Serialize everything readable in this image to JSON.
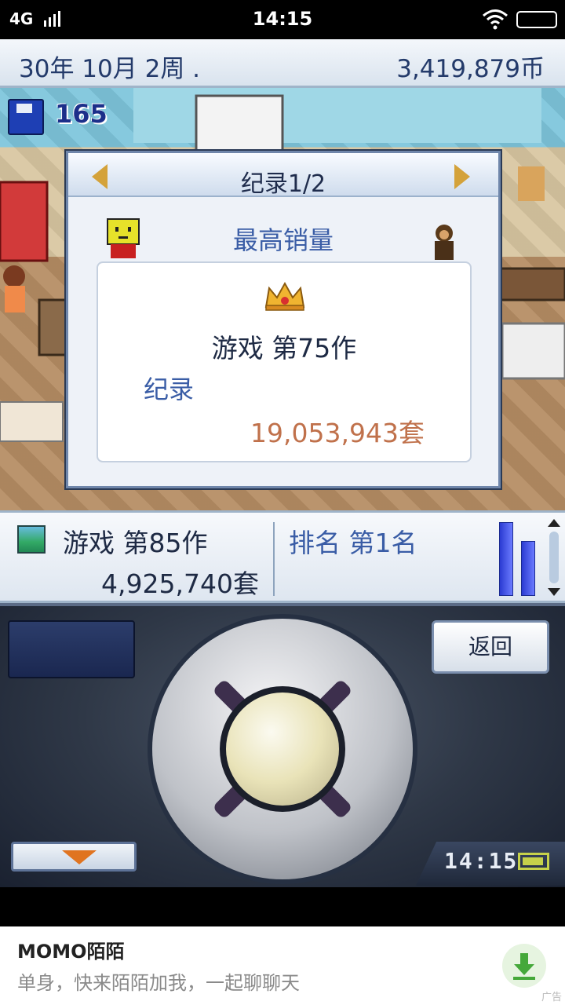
{
  "status_bar": {
    "network": "4G",
    "time": "14:15"
  },
  "top_bar": {
    "date": "30年 10月 2周 .",
    "money": "3,419,879币"
  },
  "scene": {
    "staff_count": "165"
  },
  "record_dialog": {
    "title": "纪录1/2",
    "subtitle": "最高销量",
    "game": "游戏 第75作",
    "label": "纪录",
    "value": "19,053,943套"
  },
  "info_panel": {
    "game_name": "游戏 第85作",
    "sales": "4,925,740套",
    "rank": "排名 第1名"
  },
  "controller": {
    "back_label": "返回",
    "clock": "14:15"
  },
  "ad": {
    "title": "MOMO陌陌",
    "description": "单身，快来陌陌加我，一起聊聊天",
    "tag": "广告"
  },
  "colors": {
    "accent": "#3a5da6",
    "value": "#c0714b",
    "menu_arrow": "#e07420"
  }
}
